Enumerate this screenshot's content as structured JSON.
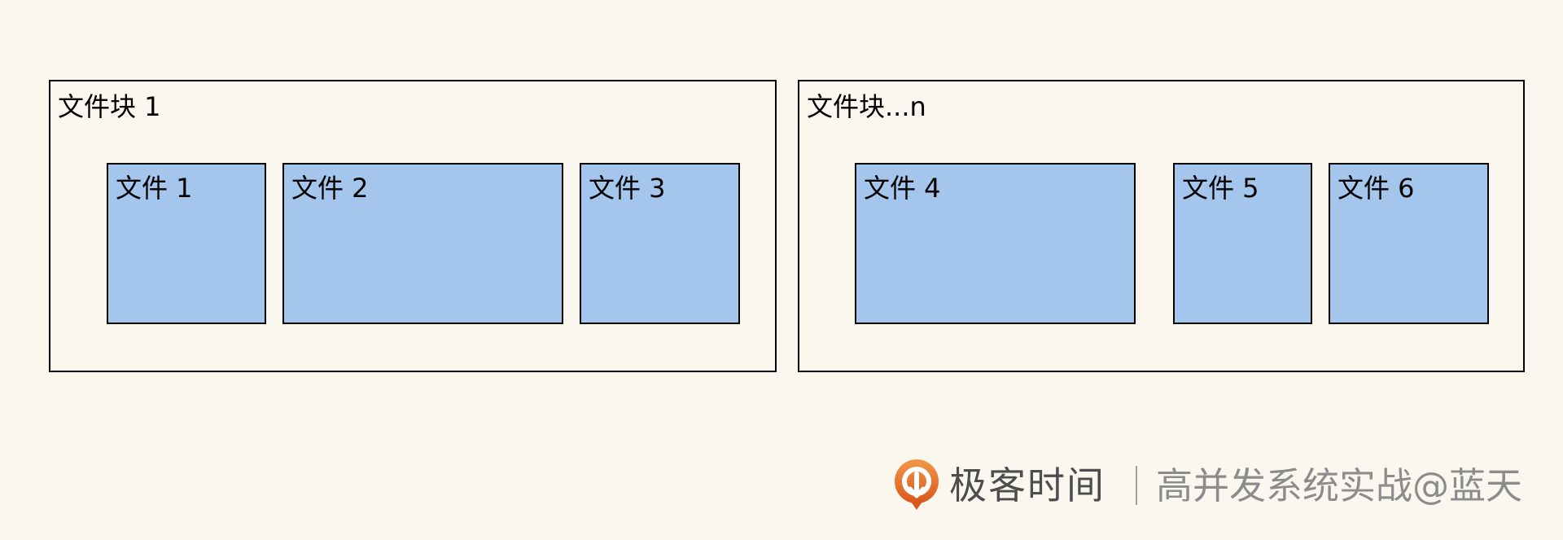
{
  "diagram": {
    "blocks": [
      {
        "label": "文件块 1",
        "files": [
          {
            "label": "文件 1"
          },
          {
            "label": "文件 2"
          },
          {
            "label": "文件 3"
          }
        ]
      },
      {
        "label": "文件块...n",
        "files": [
          {
            "label": "文件 4"
          },
          {
            "label": "文件 5"
          },
          {
            "label": "文件 6"
          }
        ]
      }
    ]
  },
  "footer": {
    "logo_icon": "geekbang-logo-icon",
    "brand": "极客时间",
    "course": "高并发系统实战@蓝天"
  },
  "colors": {
    "bg": "#faf8ee",
    "file-fill": "#a4c6ec",
    "border": "#000000",
    "brand-text": "#4d4d4d",
    "course-text": "#8c8c8c",
    "logo-orange": "#e8702a"
  }
}
